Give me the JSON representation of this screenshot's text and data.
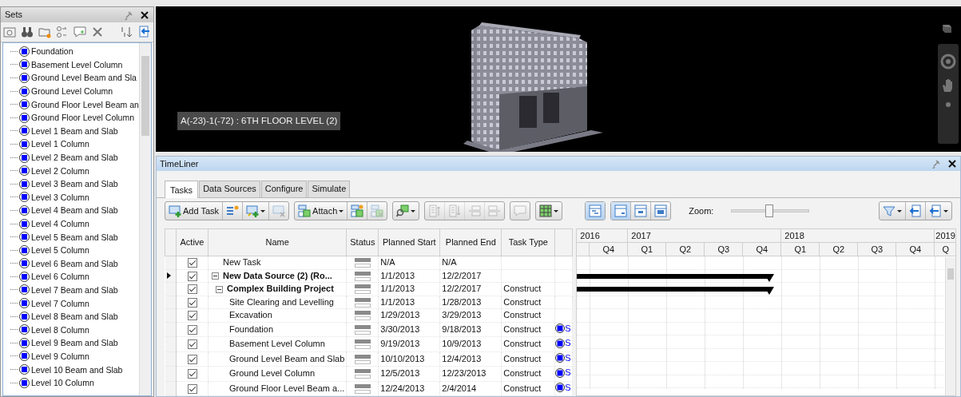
{
  "sets_panel": {
    "title": "Sets",
    "items": [
      {
        "name": "Foundation"
      },
      {
        "name": "Basement Level Column"
      },
      {
        "name": "Ground Level Beam and Sla"
      },
      {
        "name": "Ground  Level Column"
      },
      {
        "name": "Ground Floor Level Beam an"
      },
      {
        "name": "Ground Floor Level Column"
      },
      {
        "name": "Level 1 Beam and Slab"
      },
      {
        "name": "Level 1 Column"
      },
      {
        "name": "Level 2 Beam and Slab"
      },
      {
        "name": "Level 2 Column"
      },
      {
        "name": "Level 3 Beam and Slab"
      },
      {
        "name": "Level 3 Column"
      },
      {
        "name": "Level 4 Beam and Slab"
      },
      {
        "name": "Level 4 Column"
      },
      {
        "name": "Level 5 Beam and Slab"
      },
      {
        "name": "Level 5 Column"
      },
      {
        "name": "Level 6 Beam and Slab"
      },
      {
        "name": "Level 6 Column"
      },
      {
        "name": "Level 7 Beam and Slab"
      },
      {
        "name": "Level 7 Column"
      },
      {
        "name": "Level 8 Beam and Slab"
      },
      {
        "name": "Level 8 Column"
      },
      {
        "name": "Level 9 Beam and Slab"
      },
      {
        "name": "Level 9 Column"
      },
      {
        "name": "Level 10 Beam and Slab"
      },
      {
        "name": "Level 10 Column"
      }
    ]
  },
  "viewport": {
    "selection_label": "A(-23)-1(-72) : 6TH FLOOR LEVEL (2)"
  },
  "timeliner": {
    "title": "TimeLiner",
    "tabs": [
      {
        "label": "Tasks",
        "selected": true
      },
      {
        "label": "Data Sources",
        "selected": false
      },
      {
        "label": "Configure",
        "selected": false
      },
      {
        "label": "Simulate",
        "selected": false
      }
    ],
    "toolbar": [
      {
        "buttons": [
          {
            "label": "Add Task",
            "disabled": false,
            "dropdown": false
          },
          {
            "disabled": false,
            "dropdown": false
          },
          {
            "disabled": false,
            "dropdown": true
          },
          {
            "disabled": true,
            "dropdown": false
          }
        ]
      },
      {
        "buttons": [
          {
            "label": "Attach",
            "disabled": false,
            "dropdown": true
          },
          {
            "disabled": false,
            "dropdown": false
          },
          {
            "disabled": true,
            "dropdown": false
          }
        ]
      },
      {
        "buttons": [
          {
            "disabled": false,
            "dropdown": true
          }
        ]
      },
      {
        "buttons": [
          {
            "disabled": true,
            "dropdown": false
          },
          {
            "disabled": true,
            "dropdown": false
          },
          {
            "disabled": true,
            "dropdown": false
          },
          {
            "disabled": true,
            "dropdown": false
          }
        ]
      },
      {
        "buttons": [
          {
            "disabled": true,
            "dropdown": false
          }
        ]
      },
      {
        "buttons": [
          {
            "disabled": false,
            "dropdown": true
          }
        ]
      }
    ],
    "view_toggle": [
      {
        "selected": true
      }
    ],
    "view_modes": [
      {
        "selected": true
      },
      {
        "selected": false
      },
      {
        "selected": false
      }
    ],
    "zoom": {
      "label": "Zoom:",
      "level": 0.49
    },
    "right_tools": [
      {
        "dropdown": true
      },
      {
        "dropdown": false
      },
      {
        "dropdown": true
      }
    ],
    "columns": [
      "Active",
      "Name",
      "Status",
      "Planned Start",
      "Planned End",
      "Task Type"
    ],
    "tasks": [
      {
        "kind": "task",
        "name": "New Task",
        "active": true,
        "selected": false,
        "start": "N/A",
        "end": "N/A"
      },
      {
        "kind": "group",
        "name": "New Data Source (2) (Ro...",
        "expanded": true,
        "active": true,
        "selected": true,
        "start": "1/1/2013",
        "end": "12/2/2017",
        "children": [
          {
            "kind": "group",
            "name": "Complex Building Project",
            "expanded": true,
            "active": true,
            "selected": false,
            "start": "1/1/2013",
            "end": "12/2/2017",
            "task_type": "Construct",
            "children": [
              {
                "kind": "task",
                "name": "Site Clearing and Levelling",
                "active": true,
                "selected": false,
                "start": "1/1/2013",
                "end": "1/28/2013",
                "task_type": "Construct"
              },
              {
                "kind": "task",
                "name": "Excavation",
                "active": true,
                "selected": false,
                "start": "1/29/2013",
                "end": "3/29/2013",
                "task_type": "Construct"
              },
              {
                "kind": "task",
                "name": "Foundation",
                "active": true,
                "selected": false,
                "start": "3/30/2013",
                "end": "9/18/2013",
                "task_type": "Construct",
                "attached": "S"
              },
              {
                "kind": "task",
                "name": "Basement Level  Column",
                "active": true,
                "selected": false,
                "start": "9/19/2013",
                "end": "10/9/2013",
                "task_type": "Construct",
                "attached": "S"
              },
              {
                "kind": "task",
                "name": "Ground Level Beam and Slab",
                "active": true,
                "selected": false,
                "start": "10/10/2013",
                "end": "12/4/2013",
                "task_type": "Construct",
                "attached": "S"
              },
              {
                "kind": "task",
                "name": "Ground  Level Column",
                "active": true,
                "selected": false,
                "start": "12/5/2013",
                "end": "12/23/2013",
                "task_type": "Construct",
                "attached": "S"
              },
              {
                "kind": "task",
                "name": "Ground Floor Level Beam a...",
                "active": true,
                "selected": false,
                "start": "12/24/2013",
                "end": "2/4/2014",
                "task_type": "Construct",
                "attached": "S"
              }
            ]
          }
        ]
      }
    ],
    "timeline": {
      "years": [
        {
          "label": "2016",
          "quarters": [
            "Q4"
          ]
        },
        {
          "label": "2017",
          "quarters": [
            "Q1",
            "Q2",
            "Q3",
            "Q4"
          ]
        },
        {
          "label": "2018",
          "quarters": [
            "Q1",
            "Q2",
            "Q3",
            "Q4"
          ]
        },
        {
          "label": "2019",
          "quarters": [
            "Q"
          ]
        }
      ]
    }
  }
}
